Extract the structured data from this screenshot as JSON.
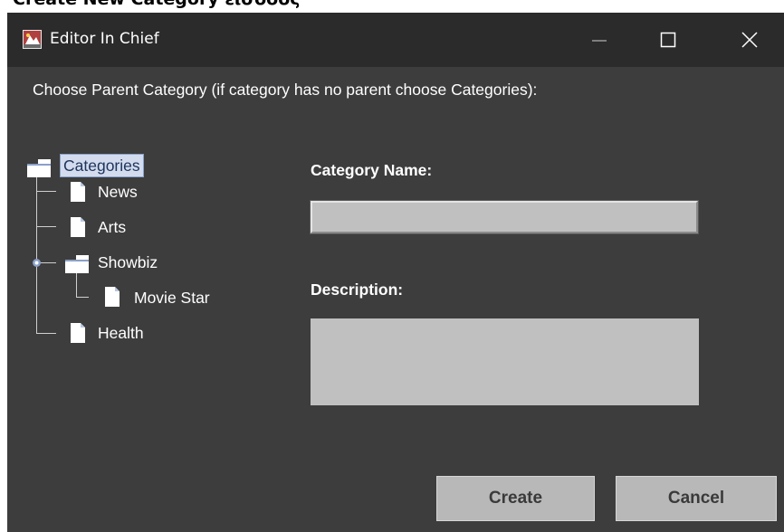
{
  "doc_heading": "Create New Category είσοδος",
  "window": {
    "title": "Editor In Chief",
    "app_icon": "editor-app-icon",
    "controls": [
      "minimize-icon",
      "maximize-icon",
      "close-icon"
    ]
  },
  "instruction": "Choose Parent Category (if category has no parent choose Categories):",
  "tree": {
    "root": {
      "label": "Categories",
      "icon": "folder-icon",
      "selected": true
    },
    "children": [
      {
        "label": "News",
        "icon": "page-icon"
      },
      {
        "label": "Arts",
        "icon": "page-icon"
      },
      {
        "label": "Showbiz",
        "icon": "folder-icon",
        "expanded": true,
        "children": [
          {
            "label": "Movie Star",
            "icon": "page-icon"
          }
        ]
      },
      {
        "label": "Health",
        "icon": "page-icon"
      }
    ]
  },
  "form": {
    "name_label": "Category Name:",
    "name_value": "",
    "description_label": "Description:",
    "description_value": ""
  },
  "buttons": {
    "create": "Create",
    "cancel": "Cancel"
  },
  "colors": {
    "window_bg": "#3d3d3d",
    "titlebar_bg": "#2b2b2b",
    "field_bg": "#c0c0c0",
    "button_bg": "#b8b8b8",
    "selection_bg": "#d2dcee"
  }
}
